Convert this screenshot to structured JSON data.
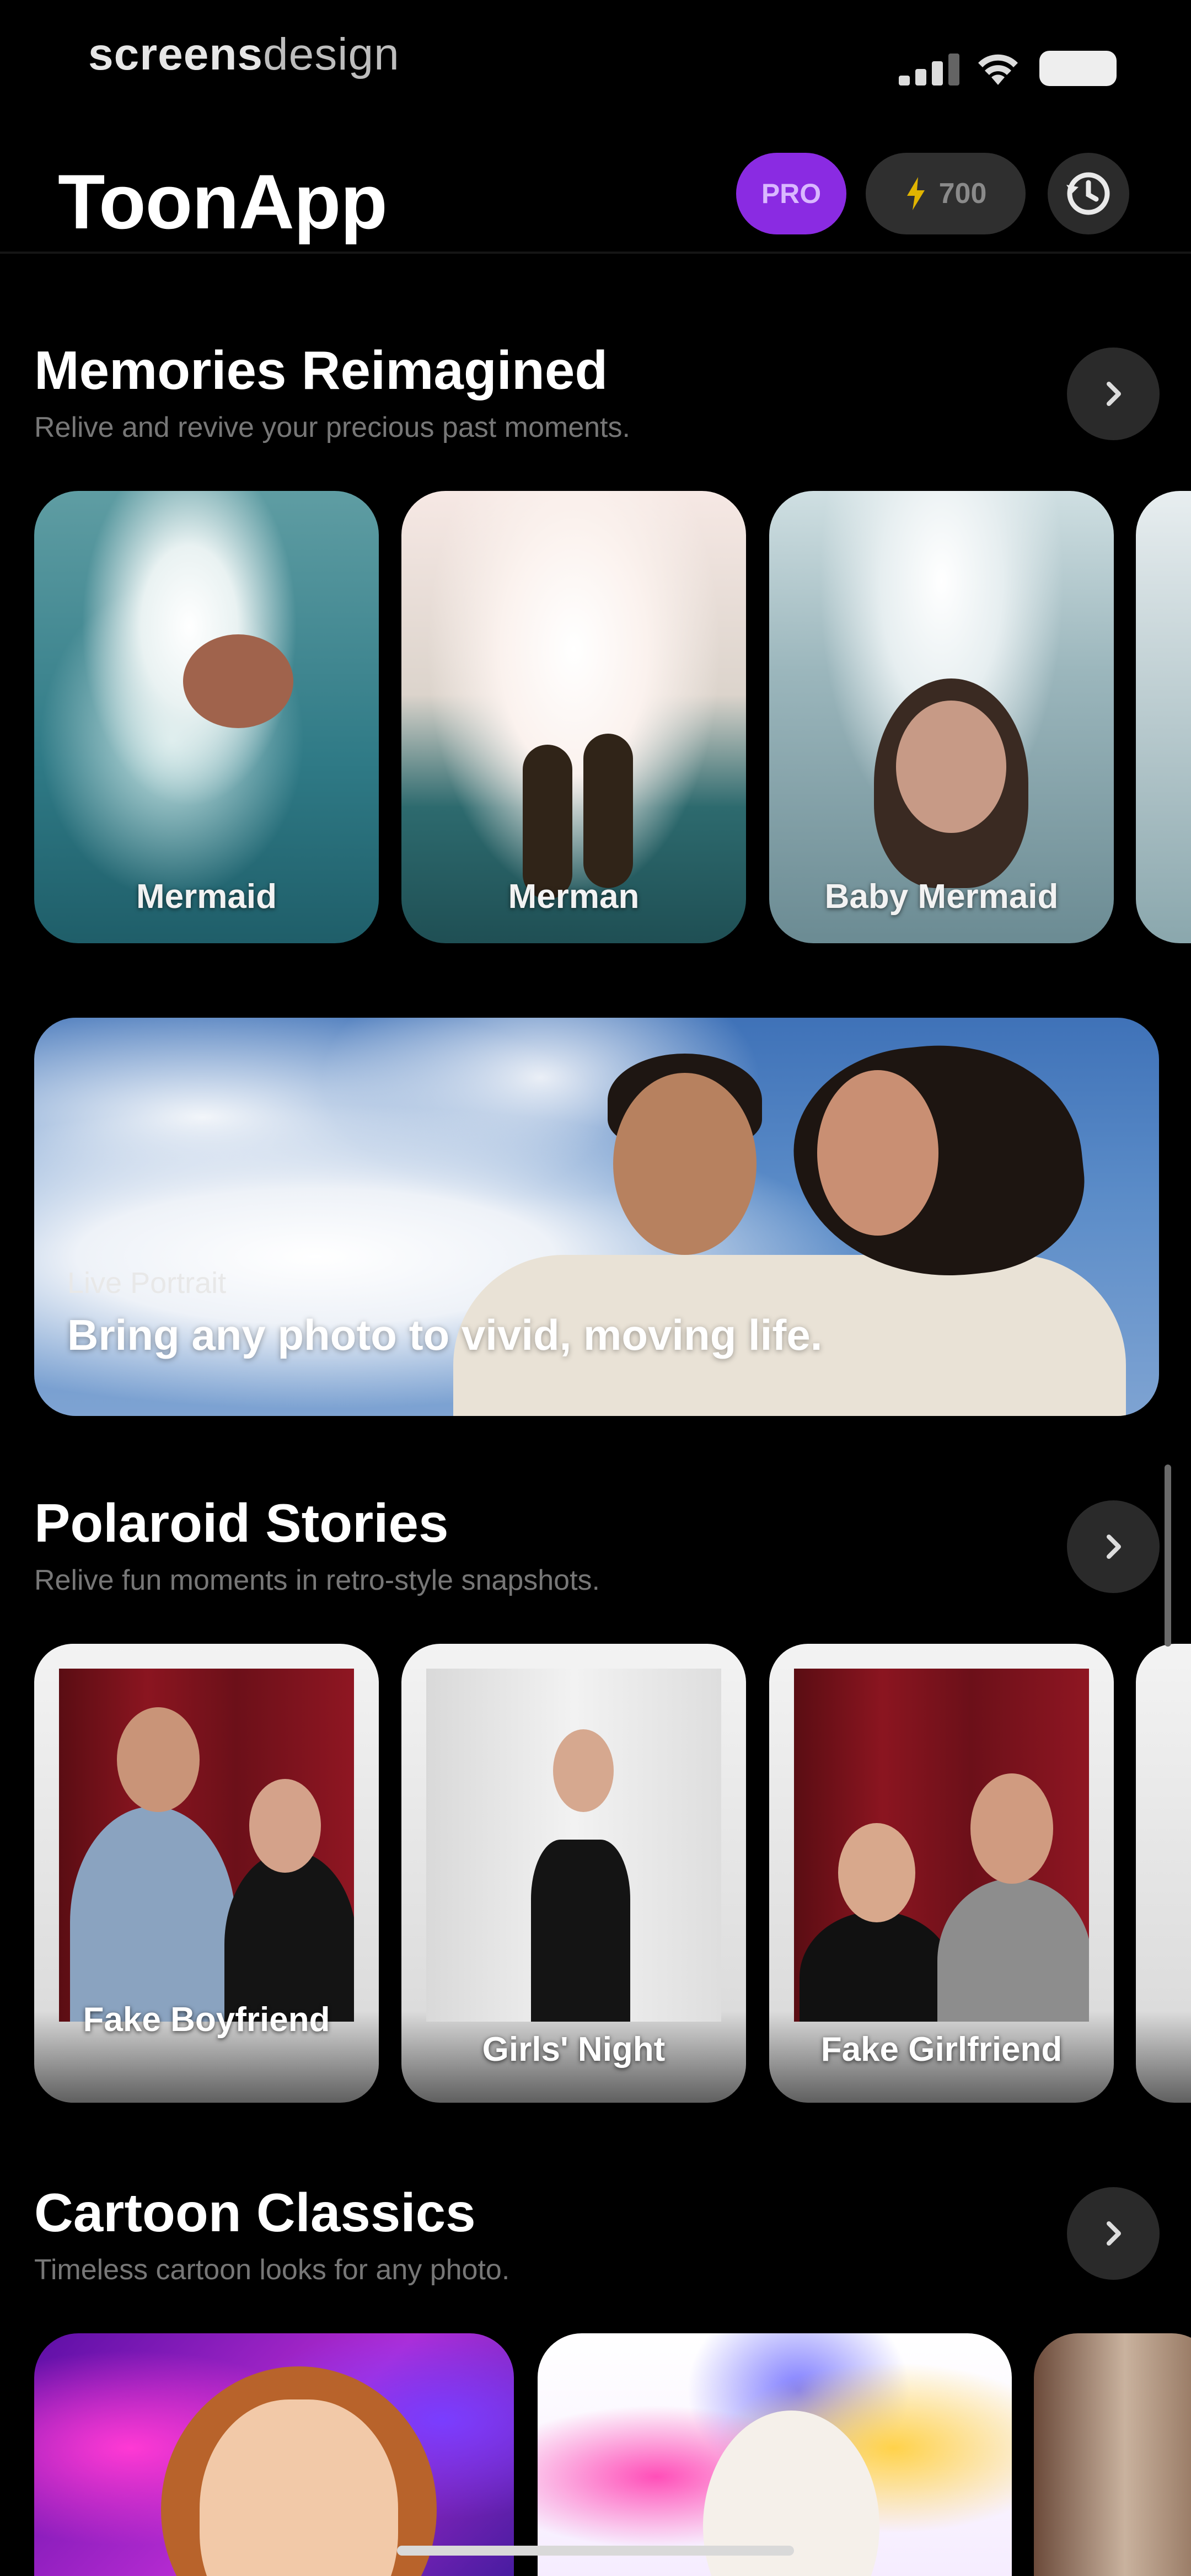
{
  "status_bar": {
    "brand_bold": "screens",
    "brand_light": "design"
  },
  "header": {
    "title": "ToonApp",
    "pro_label": "PRO",
    "credits": "700"
  },
  "sections": [
    {
      "title": "Memories Reimagined",
      "subtitle": "Relive and revive your precious past moments.",
      "cards": [
        "Mermaid",
        "Merman",
        "Baby Mermaid"
      ]
    },
    {
      "title": "Polaroid Stories",
      "subtitle": "Relive fun moments in retro-style snapshots.",
      "cards": [
        "Fake Boyfriend",
        "Girls' Night",
        "Fake Girlfriend"
      ]
    },
    {
      "title": "Cartoon Classics",
      "subtitle": "Timeless cartoon looks for any photo."
    }
  ],
  "banner": {
    "kicker": "Live Portrait",
    "headline": "Bring any photo to vivid, moving life."
  },
  "colors": {
    "pro": "#8a2be2",
    "background": "#000000",
    "pill": "#2f2f2f"
  },
  "icons": [
    "signal-icon",
    "wifi-icon",
    "battery-icon",
    "bolt-icon",
    "history-icon",
    "chevron-right-icon"
  ]
}
